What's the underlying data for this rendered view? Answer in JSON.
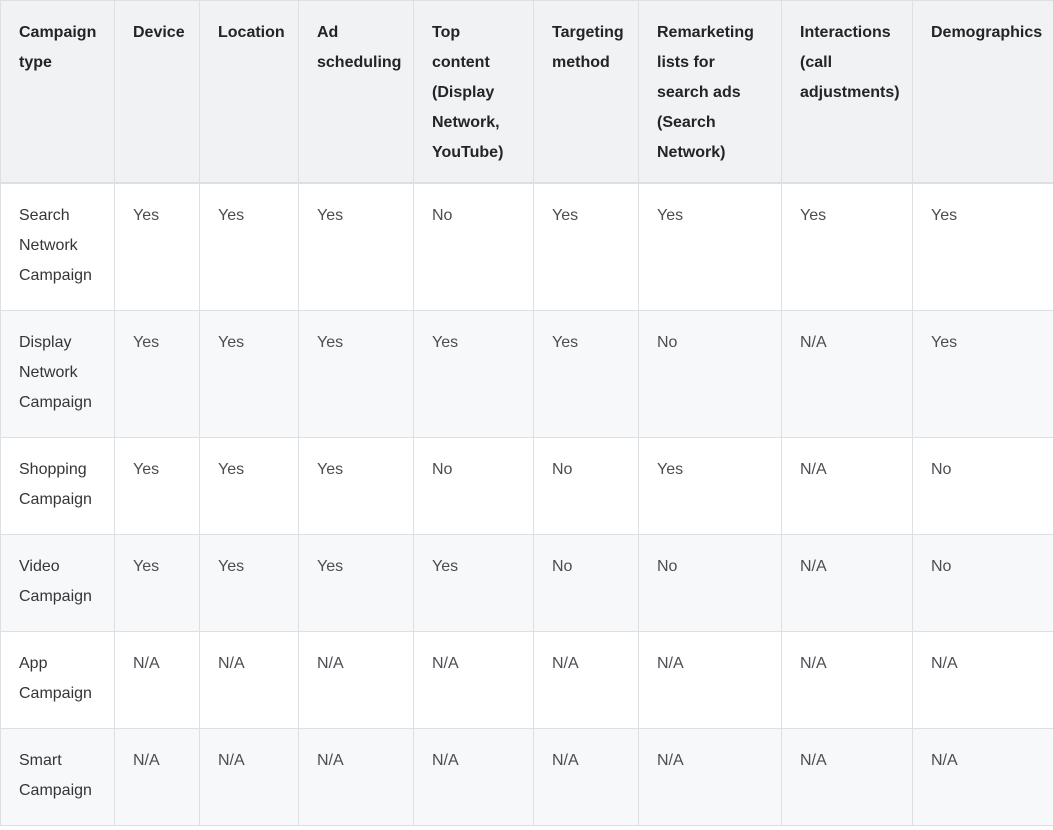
{
  "table": {
    "headers": [
      "Campaign type",
      "Device",
      "Location",
      "Ad scheduling",
      "Top content (Display Network, YouTube)",
      "Targeting method",
      "Remarketing lists for search ads (Search Network)",
      "Interactions (call adjustments)",
      "Demographics"
    ],
    "rows": [
      [
        "Search Network Campaign",
        "Yes",
        "Yes",
        "Yes",
        "No",
        "Yes",
        "Yes",
        "Yes",
        "Yes"
      ],
      [
        "Display Network Campaign",
        "Yes",
        "Yes",
        "Yes",
        "Yes",
        "Yes",
        "No",
        "N/A",
        "Yes"
      ],
      [
        "Shopping Campaign",
        "Yes",
        "Yes",
        "Yes",
        "No",
        "No",
        "Yes",
        "N/A",
        "No"
      ],
      [
        "Video Campaign",
        "Yes",
        "Yes",
        "Yes",
        "Yes",
        "No",
        "No",
        "N/A",
        "No"
      ],
      [
        "App Campaign",
        "N/A",
        "N/A",
        "N/A",
        "N/A",
        "N/A",
        "N/A",
        "N/A",
        "N/A"
      ],
      [
        "Smart Campaign",
        "N/A",
        "N/A",
        "N/A",
        "N/A",
        "N/A",
        "N/A",
        "N/A",
        "N/A"
      ]
    ]
  }
}
